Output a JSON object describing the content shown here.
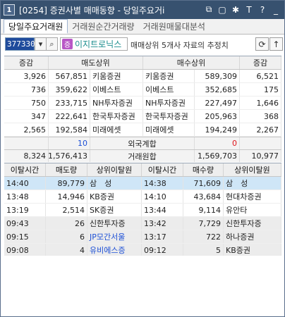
{
  "window": {
    "number": "1",
    "title": "[0254] 증권사별 매매동향 - 당일주요거i"
  },
  "tabs": [
    {
      "label": "당일주요거래원"
    },
    {
      "label": "거래원순간거래량"
    },
    {
      "label": "거래원매물대분석"
    }
  ],
  "toolbar": {
    "code": "377330",
    "stock_badge": "증",
    "stock_name": "이지트로닉스",
    "info": "매매상위 5개사 자료의 추정치"
  },
  "top_grid": {
    "headers": [
      "증감",
      "매도상위",
      "매수상위",
      "증감"
    ],
    "rows": [
      {
        "sell_change": "3,926",
        "sell_qty": "567,851",
        "sell_broker": "키움증권",
        "buy_broker": "키움증권",
        "buy_qty": "589,309",
        "buy_change": "6,521"
      },
      {
        "sell_change": "736",
        "sell_qty": "359,622",
        "sell_broker": "이베스트",
        "buy_broker": "이베스트",
        "buy_qty": "352,685",
        "buy_change": "175"
      },
      {
        "sell_change": "750",
        "sell_qty": "233,715",
        "sell_broker": "NH투자증권",
        "buy_broker": "NH투자증권",
        "buy_qty": "227,497",
        "buy_change": "1,646"
      },
      {
        "sell_change": "347",
        "sell_qty": "222,641",
        "sell_broker": "한국투자증권",
        "buy_broker": "한국투자증권",
        "buy_qty": "205,963",
        "buy_change": "368"
      },
      {
        "sell_change": "2,565",
        "sell_qty": "192,584",
        "sell_broker": "미래에셋",
        "buy_broker": "미래에셋",
        "buy_qty": "194,249",
        "buy_change": "2,267"
      }
    ],
    "foreign": {
      "sell": "10",
      "label": "외국계합",
      "buy": "0"
    },
    "total": {
      "sell_change": "8,324",
      "sell_qty": "1,576,413",
      "label": "거래원합",
      "buy_qty": "1,569,703",
      "buy_change": "10,977"
    }
  },
  "bottom_grid": {
    "headers": [
      "이탈시간",
      "매도량",
      "상위이탈원",
      "이탈시간",
      "매수량",
      "상위이탈원"
    ],
    "rows": [
      {
        "t1": "14:40",
        "q1": "89,779",
        "b1": "삼　성",
        "t2": "14:38",
        "q2": "71,609",
        "b2": "삼　성"
      },
      {
        "t1": "13:48",
        "q1": "14,946",
        "b1": "KB증권",
        "t2": "14:10",
        "q2": "43,684",
        "b2": "현대차증권"
      },
      {
        "t1": "13:19",
        "q1": "2,514",
        "b1": "SK증권",
        "t2": "13:44",
        "q2": "9,114",
        "b2": "유안타"
      },
      {
        "t1": "09:43",
        "q1": "26",
        "b1": "신한투자증",
        "t2": "13:42",
        "q2": "7,729",
        "b2": "신한투자증"
      },
      {
        "t1": "09:15",
        "q1": "6",
        "b1": "JP모간서울",
        "t2": "13:17",
        "q2": "722",
        "b2": "하나증권"
      },
      {
        "t1": "09:08",
        "q1": "4",
        "b1": "유비에스증",
        "t2": "09:12",
        "q2": "5",
        "b2": "KB증권"
      }
    ]
  },
  "colors": {
    "titlebar": "#37516f",
    "selected_row": "#cfe6f7",
    "foreign_broker": "#1c4fd6"
  }
}
